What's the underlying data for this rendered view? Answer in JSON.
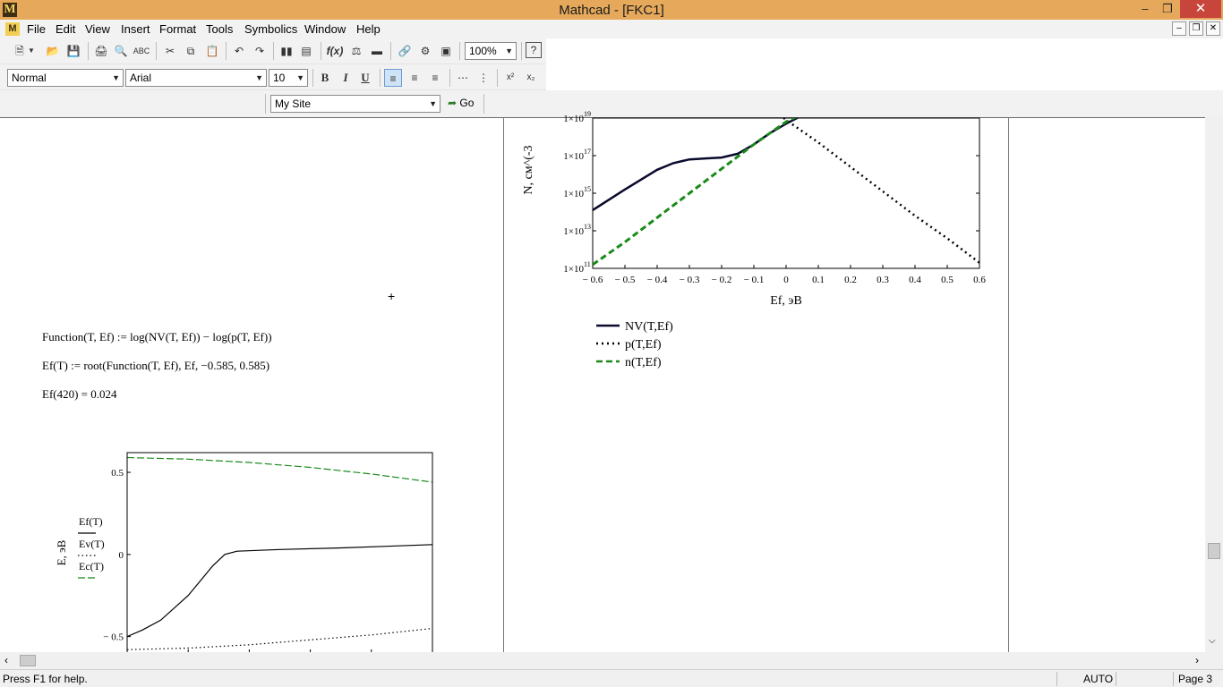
{
  "window": {
    "title": "Mathcad - [FKC1]",
    "app_icon": "M"
  },
  "menu": [
    "File",
    "Edit",
    "View",
    "Insert",
    "Format",
    "Tools",
    "Symbolics",
    "Window",
    "Help"
  ],
  "toolbar": {
    "zoom": "100%"
  },
  "format_bar": {
    "style": "Normal",
    "font": "Arial",
    "size": "10",
    "bold": "B",
    "italic": "I",
    "underline": "U"
  },
  "web_bar": {
    "site": "My Site",
    "go": "Go"
  },
  "worksheet": {
    "eq1": "Function(T, Ef) := log(NV(T, Ef)) − log(p(T, Ef))",
    "eq2": "Ef(T) := root(Function(T, Ef), Ef, −0.585, 0.585)",
    "eq3": "Ef(420) = 0.024",
    "cursor": "+"
  },
  "colors": {
    "titlebar": "#e6a95b",
    "close": "#c7453b",
    "navy": "#0a0a2e",
    "green": "#1a8a1a"
  },
  "chart_data": [
    {
      "type": "line",
      "title": "",
      "xlabel": "Ef, эВ",
      "ylabel": "N, см^(-3",
      "y_scale": "log",
      "x_ticks": [
        "− 0.6",
        "− 0.5",
        "− 0.4",
        "− 0.3",
        "− 0.2",
        "− 0.1",
        "0",
        "0.1",
        "0.2",
        "0.3",
        "0.4",
        "0.5",
        "0.6"
      ],
      "y_ticks": [
        {
          "mant": "1×10",
          "exp": "11"
        },
        {
          "mant": "1×10",
          "exp": "13"
        },
        {
          "mant": "1×10",
          "exp": "15"
        },
        {
          "mant": "1×10",
          "exp": "17"
        },
        {
          "mant": "1×10",
          "exp": "19"
        }
      ],
      "xlim": [
        -0.6,
        0.6
      ],
      "ylim_exp": [
        11,
        19
      ],
      "legend_position": "bottom-left",
      "series": [
        {
          "name": "NV(T,Ef)",
          "style": "solid",
          "color": "#0a0a2e",
          "x": [
            -0.6,
            -0.5,
            -0.4,
            -0.35,
            -0.3,
            -0.25,
            -0.2,
            -0.15,
            -0.1,
            -0.05,
            0,
            0.05,
            0.07
          ],
          "y_exp": [
            14.1,
            15.2,
            16.25,
            16.6,
            16.8,
            16.85,
            16.9,
            17.1,
            17.6,
            18.2,
            18.7,
            19.15,
            19.3
          ]
        },
        {
          "name": "p(T,Ef)",
          "style": "dotted",
          "color": "#000000",
          "x": [
            -0.02,
            0.0,
            0.1,
            0.2,
            0.3,
            0.4,
            0.5,
            0.6
          ],
          "y_exp": [
            19.2,
            18.9,
            17.7,
            16.4,
            15.1,
            13.8,
            12.6,
            11.3
          ]
        },
        {
          "name": "n(T,Ef)",
          "style": "dashed",
          "color": "#1a8a1a",
          "x": [
            -0.6,
            -0.5,
            -0.4,
            -0.3,
            -0.2,
            -0.1,
            0,
            0.07
          ],
          "y_exp": [
            11.2,
            12.4,
            13.7,
            15.0,
            16.3,
            17.6,
            18.8,
            19.4
          ]
        }
      ]
    },
    {
      "type": "line",
      "title": "",
      "xlabel": "",
      "ylabel": "E, эВ",
      "y_ticks": [
        "0.5",
        "0",
        "− 0.5"
      ],
      "y_tick_values": [
        0.5,
        0,
        -0.5
      ],
      "ylim": [
        -0.6,
        0.62
      ],
      "xlim": [
        0,
        1
      ],
      "x_tick_positions": [
        0.2,
        0.4,
        0.6,
        0.8
      ],
      "legend_position": "left",
      "series": [
        {
          "name": "Ef(T)",
          "style": "solid",
          "color": "#000000",
          "x": [
            0,
            0.05,
            0.11,
            0.2,
            0.28,
            0.32,
            0.36,
            0.5,
            0.7,
            0.85,
            1.0
          ],
          "y": [
            -0.5,
            -0.46,
            -0.4,
            -0.25,
            -0.07,
            0.0,
            0.02,
            0.03,
            0.04,
            0.05,
            0.06
          ]
        },
        {
          "name": "Ev(T)",
          "style": "dotted",
          "color": "#000000",
          "x": [
            0,
            0.2,
            0.4,
            0.6,
            0.8,
            1.0
          ],
          "y": [
            -0.58,
            -0.57,
            -0.55,
            -0.52,
            -0.49,
            -0.45
          ]
        },
        {
          "name": "Ec(T)",
          "style": "dashed",
          "color": "#1a8a1a",
          "x": [
            0,
            0.2,
            0.4,
            0.6,
            0.8,
            1.0
          ],
          "y": [
            0.59,
            0.58,
            0.56,
            0.53,
            0.49,
            0.44
          ]
        }
      ]
    }
  ],
  "status": {
    "help": "Press F1 for help.",
    "mode": "AUTO",
    "page": "Page 3"
  }
}
